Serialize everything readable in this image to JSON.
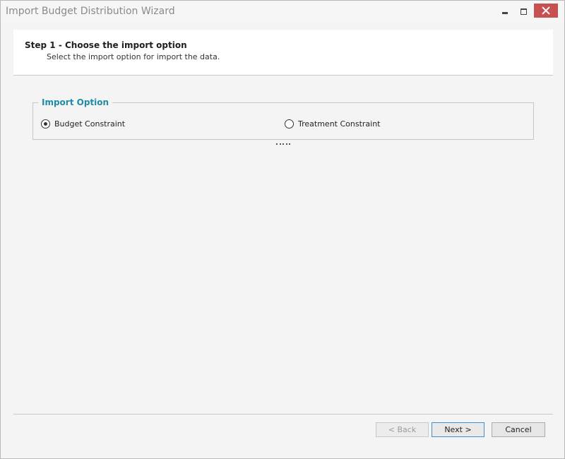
{
  "window": {
    "title": "Import Budget Distribution Wizard",
    "close_color": "#c75050"
  },
  "header": {
    "step_title": "Step 1 - Choose the import option",
    "step_description": "Select the import option for import the data."
  },
  "import_option": {
    "legend": "Import Option",
    "legend_color": "#1e8ca6",
    "options": [
      {
        "label": "Budget Constraint",
        "checked": true
      },
      {
        "label": "Treatment Constraint",
        "checked": false
      }
    ]
  },
  "footer": {
    "back_label": "< Back",
    "next_label": "Next >",
    "cancel_label": "Cancel"
  }
}
